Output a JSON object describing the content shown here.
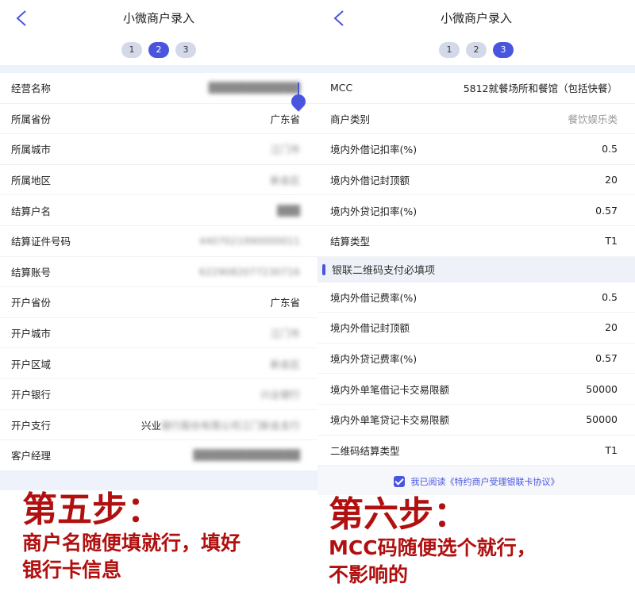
{
  "left": {
    "title": "小微商户录入",
    "steps": [
      "1",
      "2",
      "3"
    ],
    "active_step": 2,
    "rows": [
      {
        "label": "经营名称",
        "value": "████████████",
        "blur": true
      },
      {
        "label": "所属省份",
        "value": "广东省",
        "blur": false
      },
      {
        "label": "所属城市",
        "value": "江门市",
        "blur": true
      },
      {
        "label": "所属地区",
        "value": "新会区",
        "blur": true
      },
      {
        "label": "结算户名",
        "value": "███",
        "blur": true
      },
      {
        "label": "结算证件号码",
        "value": "4407021990000011",
        "blur": true
      },
      {
        "label": "结算账号",
        "value": "6229082077230716",
        "blur": true
      },
      {
        "label": "开户省份",
        "value": "广东省",
        "blur": false
      },
      {
        "label": "开户城市",
        "value": "江门市",
        "blur": true
      },
      {
        "label": "开户区域",
        "value": "新会区",
        "blur": true
      },
      {
        "label": "开户银行",
        "value": "兴业银行",
        "blur": true
      },
      {
        "label": "开户支行",
        "value_prefix": "兴业",
        "value": "银行股份有限公司江门新会支行",
        "blur": true
      },
      {
        "label": "客户经理",
        "value": "██████████████",
        "blur": true
      }
    ]
  },
  "right": {
    "title": "小微商户录入",
    "steps": [
      "1",
      "2",
      "3"
    ],
    "active_step": 3,
    "rows": [
      {
        "label": "MCC",
        "value": "5812就餐场所和餐馆（包括快餐）",
        "gray": false
      },
      {
        "label": "商户类别",
        "value": "餐饮娱乐类",
        "gray": true
      },
      {
        "label": "境内外借记扣率(%)",
        "value": "0.5"
      },
      {
        "label": "境内外借记封顶额",
        "value": "20"
      },
      {
        "label": "境内外贷记扣率(%)",
        "value": "0.57"
      },
      {
        "label": "结算类型",
        "value": "T1"
      }
    ],
    "section_title": "银联二维码支付必填项",
    "section_rows": [
      {
        "label": "境内外借记费率(%)",
        "value": "0.5"
      },
      {
        "label": "境内外借记封顶额",
        "value": "20"
      },
      {
        "label": "境内外贷记费率(%)",
        "value": "0.57"
      },
      {
        "label": "境内外单笔借记卡交易限额",
        "value": "50000"
      },
      {
        "label": "境内外单笔贷记卡交易限额",
        "value": "50000"
      },
      {
        "label": "二维码结算类型",
        "value": "T1"
      }
    ],
    "agreement": "我已阅读《特约商户受理银联卡协议》"
  },
  "captions": {
    "left_step": "第五步：",
    "left_line1": "商户名随便填就行，填好",
    "left_line2": "银行卡信息",
    "right_step": "第六步：",
    "right_line1": "MCC码随便选个就行，",
    "right_line2": "不影响的"
  },
  "colors": {
    "accent": "#4a55df",
    "caption": "#b0100f"
  }
}
